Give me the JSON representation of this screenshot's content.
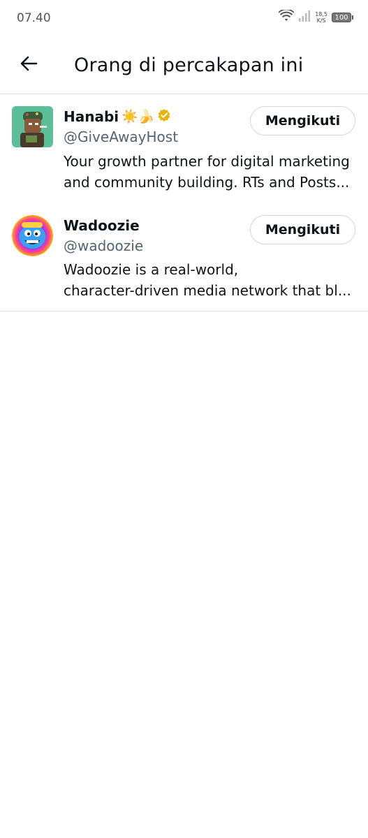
{
  "status_bar": {
    "time": "07.40",
    "net_speed_value": "18,5",
    "net_speed_unit": "K/S",
    "battery": "100"
  },
  "header": {
    "title": "Orang di percakapan ini",
    "back_icon": "arrow-left-icon"
  },
  "users": [
    {
      "name": "Hanabi",
      "emojis": "☀️🍌",
      "verified": true,
      "handle": "@GiveAwayHost",
      "bio_line1": "Your growth partner for digital marketing",
      "bio_line2": "and community building. RTs and Posts...",
      "follow_label": "Mengikuti"
    },
    {
      "name": "Wadoozie",
      "handle": "@wadoozie",
      "bio_line1": "Wadoozie is a real-world,",
      "bio_line2": "character-driven media network that bl...",
      "follow_label": "Mengikuti"
    }
  ],
  "colors": {
    "text_primary": "#0f1419",
    "text_secondary": "#536471",
    "divider": "#e1e4e7",
    "verified_gold": "#e8b400"
  }
}
